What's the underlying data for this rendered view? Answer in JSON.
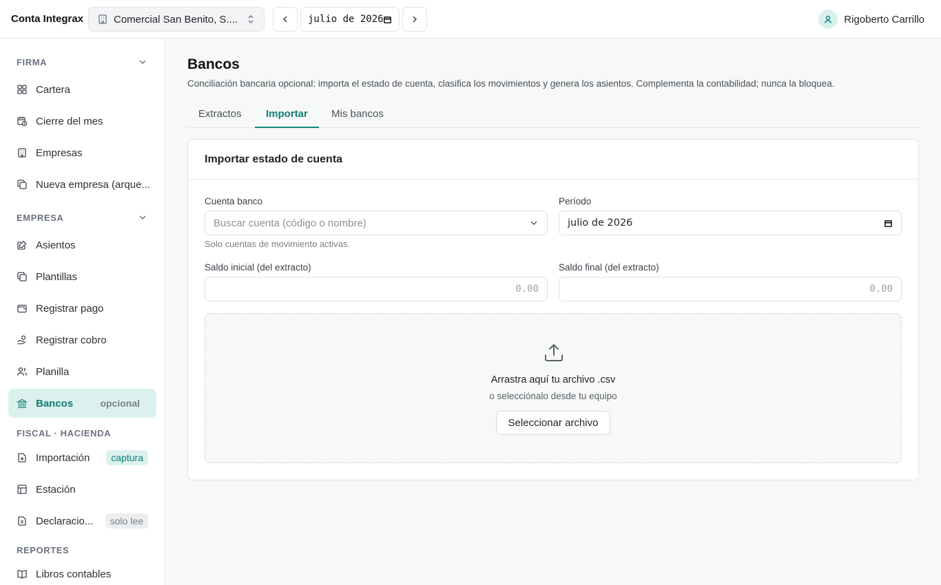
{
  "topbar": {
    "brand": "Conta Integrax",
    "company": "Comercial San Benito, S....",
    "period": "julio de 2026",
    "user_name": "Rigoberto Carrillo"
  },
  "sidebar": {
    "sections": [
      {
        "title": "FIRMA",
        "items": [
          {
            "label": "Cartera",
            "icon": "grid-icon"
          },
          {
            "label": "Cierre del mes",
            "icon": "calendar-clock-icon"
          },
          {
            "label": "Empresas",
            "icon": "building-icon"
          },
          {
            "label": "Nueva empresa (arque...",
            "icon": "copy-icon"
          }
        ]
      },
      {
        "title": "EMPRESA",
        "items": [
          {
            "label": "Asientos",
            "icon": "edit-note-icon"
          },
          {
            "label": "Plantillas",
            "icon": "copy-icon"
          },
          {
            "label": "Registrar pago",
            "icon": "wallet-icon"
          },
          {
            "label": "Registrar cobro",
            "icon": "hand-coins-icon"
          },
          {
            "label": "Planilla",
            "icon": "users-icon"
          },
          {
            "label": "Bancos",
            "icon": "bank-icon",
            "badge": "opcional",
            "active": true
          }
        ]
      },
      {
        "title": "FISCAL · HACIENDA",
        "items": [
          {
            "label": "Importación",
            "icon": "file-import-icon",
            "badge": "captura"
          },
          {
            "label": "Estación",
            "icon": "table-icon"
          },
          {
            "label": "Declaracio...",
            "icon": "file-text-icon",
            "badge": "solo lee"
          }
        ]
      },
      {
        "title": "REPORTES",
        "items": [
          {
            "label": "Libros contables",
            "icon": "book-open-icon"
          }
        ]
      }
    ]
  },
  "main": {
    "title": "Bancos",
    "subtitle": "Conciliación bancaria opcional: importa el estado de cuenta, clasifica los movimientos y genera los asientos. Complementa la contabilidad; nunca la bloquea.",
    "tabs": [
      {
        "label": "Extractos"
      },
      {
        "label": "Importar",
        "active": true
      },
      {
        "label": "Mis bancos"
      }
    ],
    "card": {
      "title": "Importar estado de cuenta",
      "account_label": "Cuenta banco",
      "account_placeholder": "Buscar cuenta (código o nombre)",
      "account_hint": "Solo cuentas de movimiento activas.",
      "period_label": "Período",
      "period_value": "julio de 2026",
      "opening_label": "Saldo inicial (del extracto)",
      "opening_placeholder": "0.00",
      "closing_label": "Saldo final (del extracto)",
      "closing_placeholder": "0.00",
      "drop_title": "Arrastra aquí tu archivo .csv",
      "drop_sub": "o selecciónalo desde tu equipo",
      "select_button": "Seleccionar archivo"
    }
  },
  "colors": {
    "accent": "#0f8a80",
    "active_bg": "#dbf1ee"
  }
}
